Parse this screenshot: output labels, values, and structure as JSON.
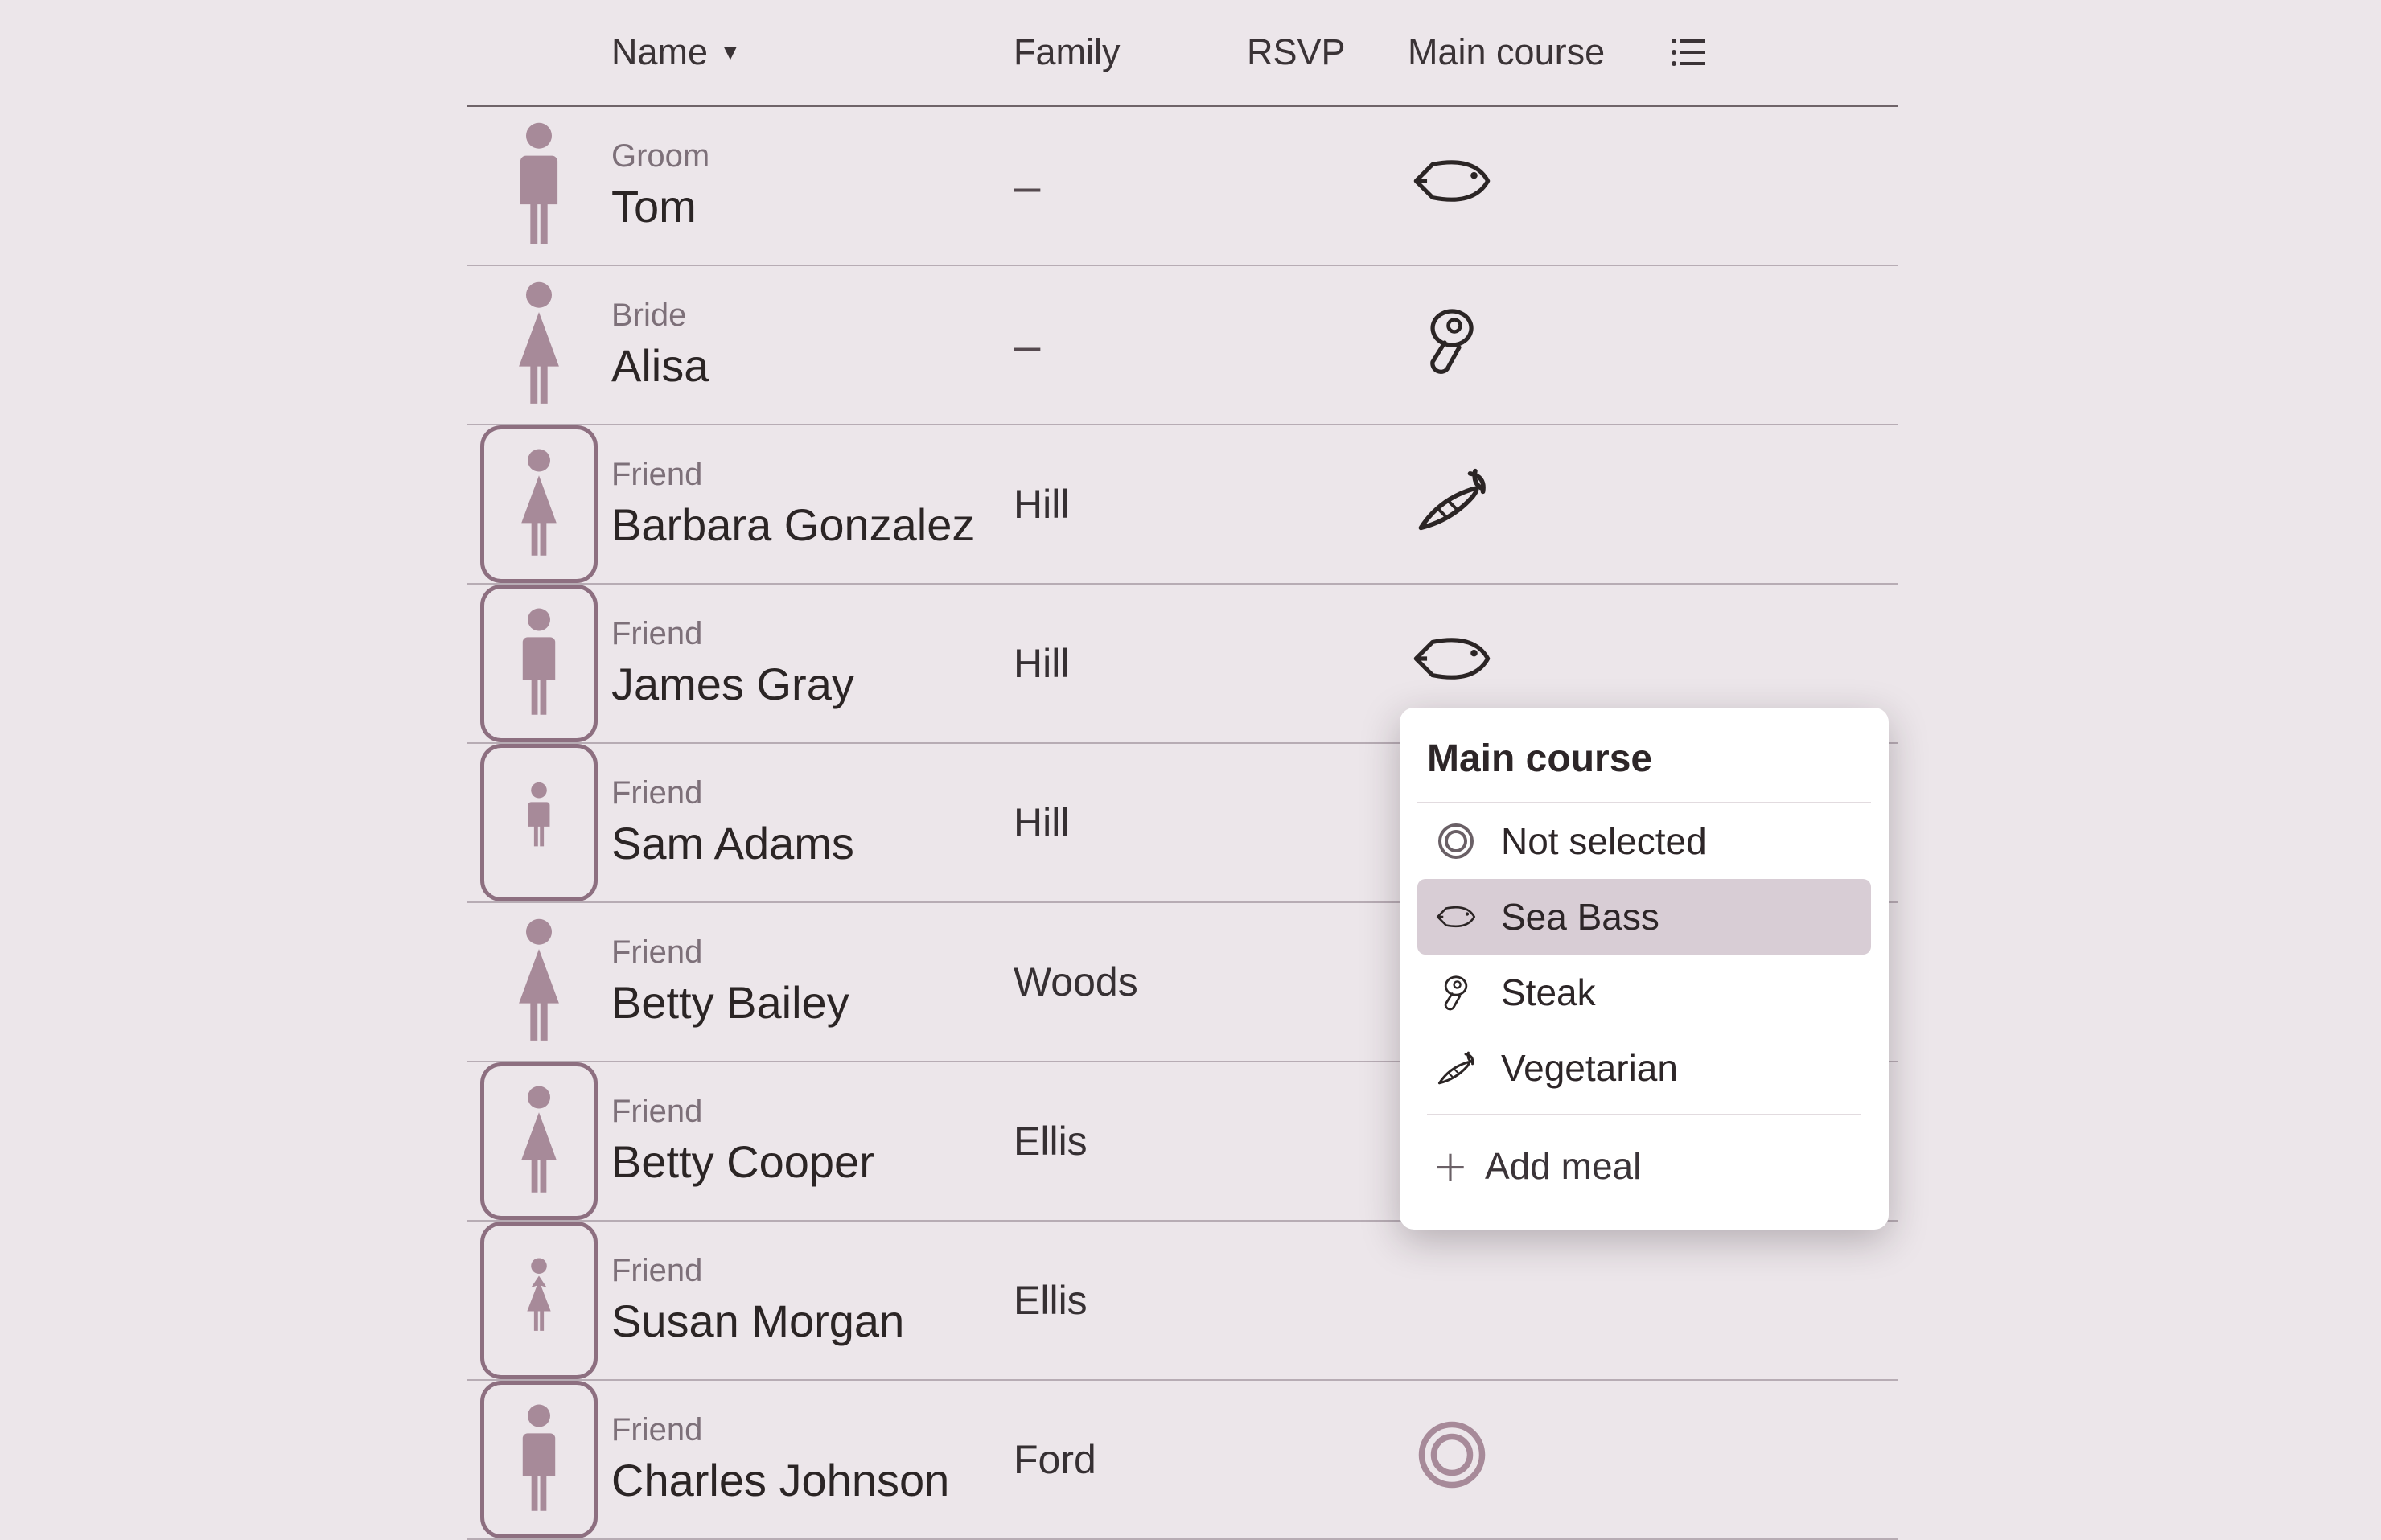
{
  "columns": {
    "name": "Name",
    "family": "Family",
    "rsvp": "RSVP",
    "main_course": "Main course"
  },
  "guests": [
    {
      "role": "Groom",
      "name": "Tom",
      "family": "–",
      "avatar": "man",
      "boxed": false,
      "rsvp": "dark",
      "meal": "fish"
    },
    {
      "role": "Bride",
      "name": "Alisa",
      "family": "–",
      "avatar": "woman",
      "boxed": false,
      "rsvp": "dark",
      "meal": "steak"
    },
    {
      "role": "Friend",
      "name": "Barbara Gonzalez",
      "family": "Hill",
      "avatar": "woman",
      "boxed": true,
      "rsvp": "light",
      "meal": "veg"
    },
    {
      "role": "Friend",
      "name": "James Gray",
      "family": "Hill",
      "avatar": "man",
      "boxed": true,
      "rsvp": "light",
      "meal": "fish"
    },
    {
      "role": "Friend",
      "name": "Sam Adams",
      "family": "Hill",
      "avatar": "boy",
      "boxed": true,
      "rsvp": null,
      "meal": null
    },
    {
      "role": "Friend",
      "name": "Betty Bailey",
      "family": "Woods",
      "avatar": "woman",
      "boxed": false,
      "rsvp": null,
      "meal": null
    },
    {
      "role": "Friend",
      "name": "Betty Cooper",
      "family": "Ellis",
      "avatar": "woman",
      "boxed": true,
      "rsvp": null,
      "meal": null
    },
    {
      "role": "Friend",
      "name": "Susan Morgan",
      "family": "Ellis",
      "avatar": "girl",
      "boxed": true,
      "rsvp": null,
      "meal": null
    },
    {
      "role": "Friend",
      "name": "Charles Johnson",
      "family": "Ford",
      "avatar": "man",
      "boxed": true,
      "rsvp": "light",
      "meal": "none"
    }
  ],
  "popup": {
    "title": "Main course",
    "options": [
      {
        "key": "none",
        "label": "Not selected"
      },
      {
        "key": "fish",
        "label": "Sea Bass"
      },
      {
        "key": "steak",
        "label": "Steak"
      },
      {
        "key": "veg",
        "label": "Vegetarian"
      }
    ],
    "selected": "fish",
    "add_label": "Add meal"
  }
}
